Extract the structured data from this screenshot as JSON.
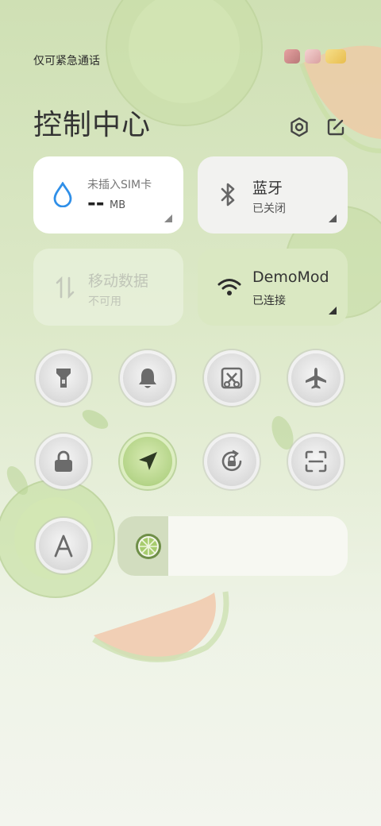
{
  "status": {
    "carrier": "仅可紧急通话",
    "icons": [
      "shop-icon",
      "bunny-icon",
      "duck-icon"
    ]
  },
  "header": {
    "title": "控制中心",
    "icons": [
      "settings-icon",
      "edit-icon"
    ]
  },
  "tiles": {
    "data_usage": {
      "label": "未插入SIM卡",
      "value": "--",
      "unit": "MB"
    },
    "bluetooth": {
      "label": "蓝牙",
      "status": "已关闭"
    },
    "mobile_data": {
      "label": "移动数据",
      "status": "不可用"
    },
    "wifi": {
      "label": "DemoMod",
      "status": "已连接"
    }
  },
  "toggles": [
    {
      "icon": "flashlight-icon",
      "active": false
    },
    {
      "icon": "bell-icon",
      "active": false
    },
    {
      "icon": "screenshot-icon",
      "active": false
    },
    {
      "icon": "airplane-icon",
      "active": false
    },
    {
      "icon": "lock-icon",
      "active": false
    },
    {
      "icon": "location-icon",
      "active": true
    },
    {
      "icon": "rotation-lock-icon",
      "active": false
    },
    {
      "icon": "scan-icon",
      "active": false
    },
    {
      "icon": "font-icon",
      "active": false
    }
  ],
  "brightness": {
    "level_percent": 22,
    "icon": "brightness-lime-icon"
  },
  "colors": {
    "accent": "#b6d58a",
    "tile_white": "#ffffff",
    "text": "#333333"
  }
}
